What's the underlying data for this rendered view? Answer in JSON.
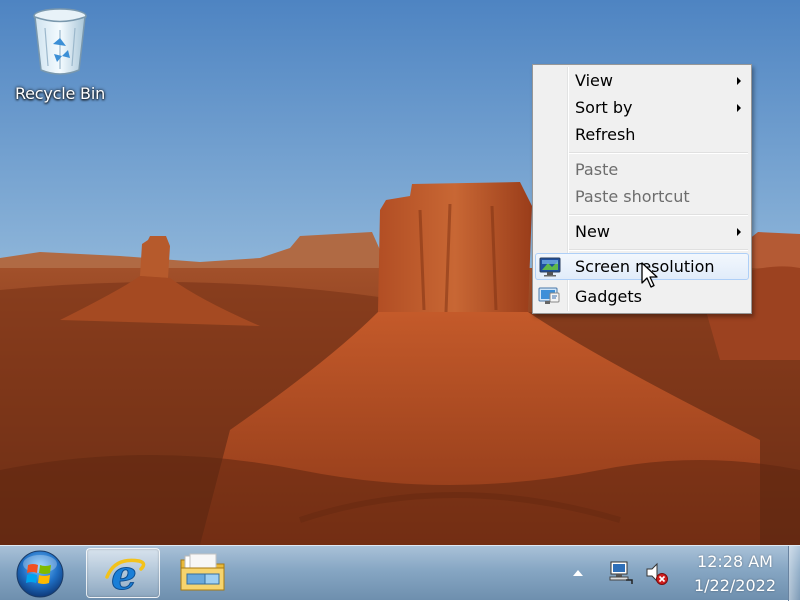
{
  "desktop": {
    "icons": [
      {
        "label": "Recycle Bin",
        "icon": "recycle-bin-icon"
      }
    ]
  },
  "context_menu": {
    "items": [
      {
        "label": "View",
        "submenu": true,
        "enabled": true
      },
      {
        "label": "Sort by",
        "submenu": true,
        "enabled": true
      },
      {
        "label": "Refresh",
        "submenu": false,
        "enabled": true
      },
      {
        "label": "Paste",
        "submenu": false,
        "enabled": false
      },
      {
        "label": "Paste shortcut",
        "submenu": false,
        "enabled": false
      },
      {
        "label": "New",
        "submenu": true,
        "enabled": true
      },
      {
        "label": "Screen resolution",
        "submenu": false,
        "enabled": true,
        "highlighted": true,
        "icon": "display-icon"
      },
      {
        "label": "Gadgets",
        "submenu": false,
        "enabled": true,
        "icon": "gadgets-icon"
      }
    ]
  },
  "taskbar": {
    "start_icon": "windows-logo-icon",
    "pinned": [
      {
        "name": "Internet Explorer",
        "icon": "internet-explorer-icon",
        "active": true
      },
      {
        "name": "Windows Explorer",
        "icon": "folder-icon",
        "active": false
      }
    ],
    "tray": {
      "icons": [
        "show-hidden-icons-arrow",
        "network-icon",
        "volume-muted-icon"
      ]
    },
    "clock": {
      "time": "12:28 AM",
      "date": "1/22/2022"
    }
  },
  "colors": {
    "menu_highlight_border": "#aecff7",
    "menu_background": "#f0f0f0",
    "taskbar": "#86a6c3"
  }
}
